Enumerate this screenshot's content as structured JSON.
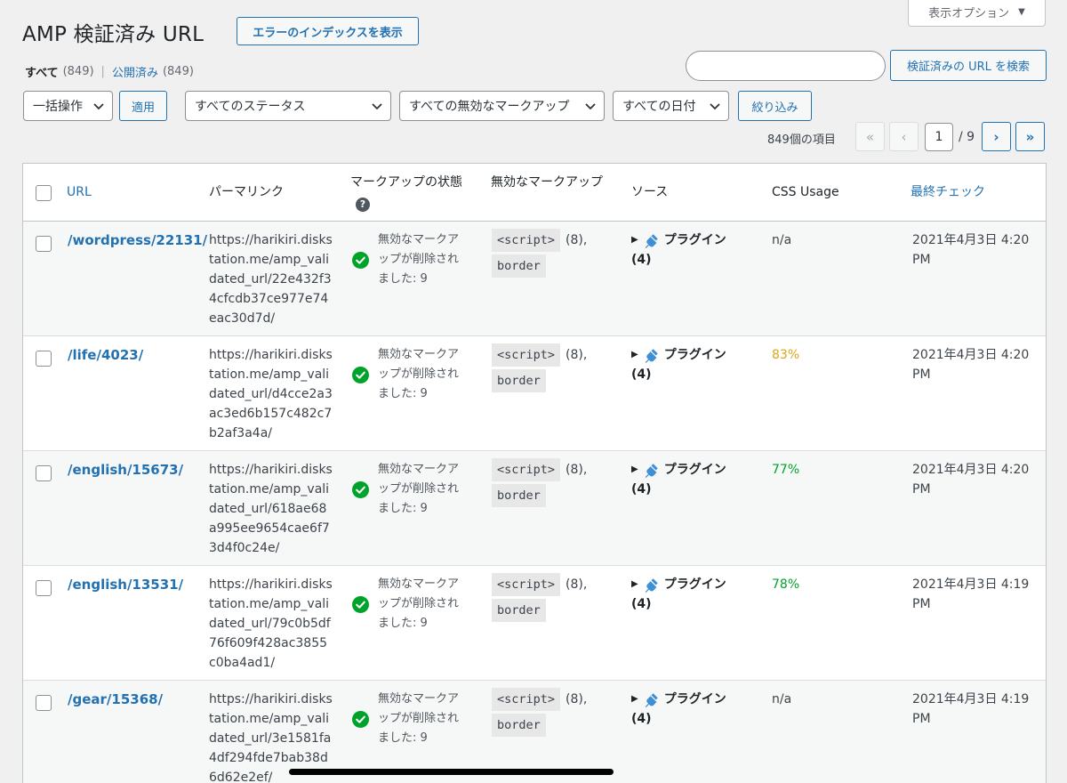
{
  "screen_options": {
    "label": "表示オプション",
    "arrow": "▼"
  },
  "title": "AMP 検証済み URL",
  "title_action": "エラーのインデックスを表示",
  "views": {
    "all_label": "すべて",
    "all_count": "(849)",
    "separator": "|",
    "published_label": "公開済み",
    "published_count": "(849)"
  },
  "search": {
    "placeholder": "",
    "button": "検証済みの URL を検索"
  },
  "filters": {
    "bulk_action": "一括操作",
    "apply": "適用",
    "status": "すべてのステータス",
    "markup": "すべての無効なマークアップ",
    "date": "すべての日付",
    "filter_button": "絞り込み"
  },
  "pagination": {
    "items": "849個の項目",
    "first": "«",
    "prev": "‹",
    "current": "1",
    "total": "/ 9",
    "next": "›",
    "last": "»"
  },
  "columns": {
    "url": "URL",
    "permalink": "パーマリンク",
    "markup_status": "マークアップの状態",
    "invalid_markup": "無効なマークアップ",
    "source": "ソース",
    "css_usage": "CSS Usage",
    "last_checked": "最終チェック",
    "help": "?"
  },
  "rows": [
    {
      "url": "/wordpress/22131/",
      "permalink": "https://harikiri.diskstation.me/amp_validated_url/22e432f34cfcdb37ce977e74eac30d7d/",
      "status": "無効なマークアップが削除されました: 9",
      "markup_tag": "<script>",
      "markup_count": "(8),",
      "markup_attr": "border",
      "source": "プラグイン",
      "source_count": "(4)",
      "css": "n/a",
      "css_kind": "na",
      "date": "2021年4月3日 4:20 PM"
    },
    {
      "url": "/life/4023/",
      "permalink": "https://harikiri.diskstation.me/amp_validated_url/d4cce2a3ac3ed6b157c482c7b2af3a4a/",
      "status": "無効なマークアップが削除されました: 9",
      "markup_tag": "<script>",
      "markup_count": "(8),",
      "markup_attr": "border",
      "source": "プラグイン",
      "source_count": "(4)",
      "css": "83%",
      "css_kind": "orange",
      "date": "2021年4月3日 4:20 PM"
    },
    {
      "url": "/english/15673/",
      "permalink": "https://harikiri.diskstation.me/amp_validated_url/618ae68a995ee9654cae6f73d4f0c24e/",
      "status": "無効なマークアップが削除されました: 9",
      "markup_tag": "<script>",
      "markup_count": "(8),",
      "markup_attr": "border",
      "source": "プラグイン",
      "source_count": "(4)",
      "css": "77%",
      "css_kind": "green",
      "date": "2021年4月3日 4:20 PM"
    },
    {
      "url": "/english/13531/",
      "permalink": "https://harikiri.diskstation.me/amp_validated_url/79c0b5df76f609f428ac3855c0ba4ad1/",
      "status": "無効なマークアップが削除されました: 9",
      "markup_tag": "<script>",
      "markup_count": "(8),",
      "markup_attr": "border",
      "source": "プラグイン",
      "source_count": "(4)",
      "css": "78%",
      "css_kind": "green",
      "date": "2021年4月3日 4:19 PM"
    },
    {
      "url": "/gear/15368/",
      "permalink": "https://harikiri.diskstation.me/amp_validated_url/3e1581fa4df294fde7bab38d6d62e2ef/",
      "status": "無効なマークアップが削除されました: 9",
      "markup_tag": "<script>",
      "markup_count": "(8),",
      "markup_attr": "border",
      "source": "プラグイン",
      "source_count": "(4)",
      "css": "n/a",
      "css_kind": "na",
      "date": "2021年4月3日 4:19 PM"
    }
  ],
  "colors": {
    "accent": "#2271b1",
    "success": "#00a32a",
    "warning": "#dba617"
  }
}
